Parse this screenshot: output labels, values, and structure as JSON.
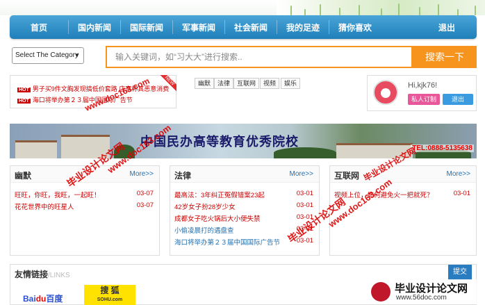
{
  "nav": {
    "items": [
      "首页",
      "国内新闻",
      "国际新闻",
      "军事新闻",
      "社会新闻",
      "我的足迹",
      "猜你喜欢"
    ],
    "logout": "退出"
  },
  "search": {
    "category": "Select The Category",
    "placeholder": "输入关键词，如“习大大”进行搜索..",
    "button": "搜索一下"
  },
  "hot": {
    "badge": "HOT",
    "new_label": "NEW",
    "items": [
      "男子买9件文胸发现搞低价套路 店家称其恶意消费",
      "海口将举办第２３届中国国际广告节"
    ]
  },
  "tags": [
    "幽默",
    "法律",
    "互联网",
    "视频",
    "娱乐"
  ],
  "user": {
    "greeting": "Hi,kjk76!",
    "subscribe": "私人订制",
    "logout": "退出"
  },
  "banner": {
    "title": "中国民办高等教育优秀院校",
    "tel": "TEL:0888-5135638"
  },
  "boxes": [
    {
      "title": "幽默",
      "more": "More>>",
      "items": [
        {
          "text": "旺旺，你旺，我旺，一起旺！",
          "date": "03-07"
        },
        {
          "text": "花花世界中的旺星人",
          "date": "03-07"
        }
      ]
    },
    {
      "title": "法律",
      "more": "More>>",
      "items": [
        {
          "text": "最高法：3年纠正冤假错案23起",
          "date": "03-01"
        },
        {
          "text": "42岁女子扮28岁少女",
          "date": "03-01"
        },
        {
          "text": "成都女子吃火锅后大小便失禁",
          "date": "03-01"
        },
        {
          "text": "小偷凌晨打的遇盘查",
          "date": "03-01"
        },
        {
          "text": "海口将举办第２３届中国国际广告节",
          "date": "03-01"
        }
      ]
    },
    {
      "title": "互联网",
      "more": "More>>",
      "items": [
        {
          "text": "视频上位，如何避免火一把就死？",
          "date": "03-01"
        }
      ]
    }
  ],
  "links": {
    "title": "友情链接",
    "subtitle": "/LINKS",
    "submit": "提交",
    "baidu": "Bai",
    "baidu_red": "du",
    "baidu_cn": "百度",
    "sohu": "搜 狐",
    "sohu_en": "SOHU.com"
  },
  "watermarks": {
    "a": "毕业设计论文网",
    "b": "www.doc163.com",
    "c": "毕业设计论文网",
    "d": "www.doc163.com",
    "e": "毕业设计论文网",
    "f": "www.doc163.com"
  },
  "logo": {
    "name": "毕业设计论文网",
    "url": "www.56doc.com"
  },
  "colors": {
    "nav": "#1f7fb9",
    "search_accent": "#f7941d",
    "hot_red": "#cc0000",
    "subscribe": "#e8579a",
    "logout": "#3a9be0"
  }
}
